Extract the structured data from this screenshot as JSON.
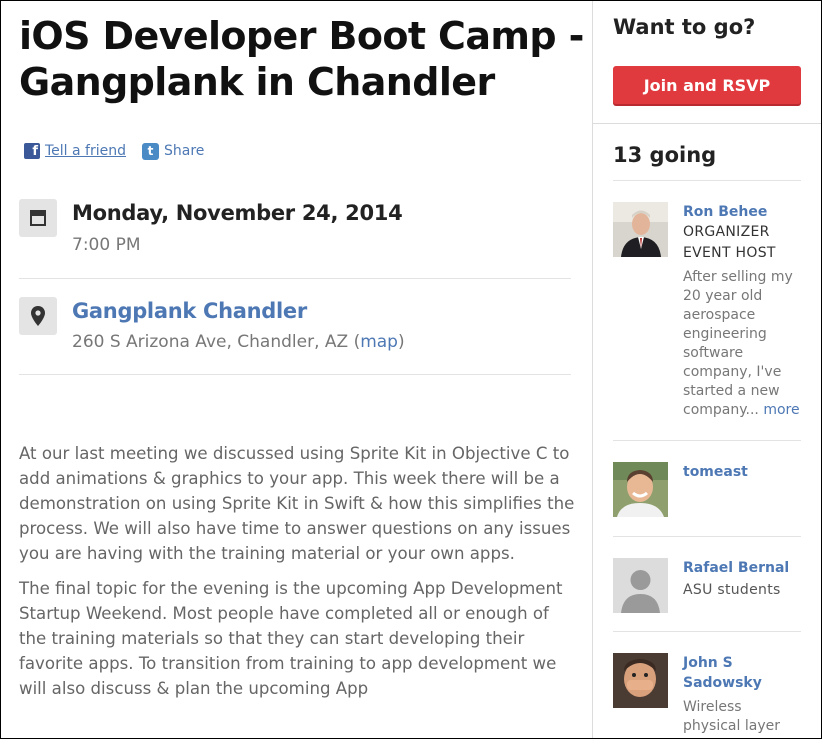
{
  "event": {
    "title": "iOS Developer Boot Camp - Gangplank in Chandler",
    "share": {
      "tell_friend": "Tell a friend",
      "share": "Share"
    },
    "date": "Monday, November 24, 2014",
    "time": "7:00 PM",
    "venue": {
      "name": "Gangplank Chandler",
      "address": "260 S Arizona Ave, Chandler, AZ",
      "map_open": "(",
      "map_label": "map",
      "map_close": ")"
    },
    "description": [
      "At our last meeting we discussed using Sprite Kit in Objective C to add animations & graphics to your app.  This week there will be a demonstration on using Sprite Kit in Swift & how this simplifies the process.  We will also have time to answer questions on any issues you are having with the training material or your own apps.",
      "The final topic for the evening is the upcoming App Development Startup Weekend.  Most people have completed all or enough of the training materials so that they can start developing their favorite apps.  To transition from training to app development we will also discuss & plan the upcoming App"
    ]
  },
  "sidebar": {
    "want_to_go": "Want to go?",
    "rsvp_label": "Join and RSVP",
    "going": "13 going",
    "members": [
      {
        "name": "Ron Behee",
        "role1": "ORGANIZER",
        "role2": "EVENT HOST",
        "bio": "After selling my 20 year old aerospace engineering software company, I've started a new company...",
        "more": "more",
        "avatar_icon": "photo-suit-avatar"
      },
      {
        "name": "tomeast",
        "avatar_icon": "photo-smiling-avatar"
      },
      {
        "name": "Rafael Bernal",
        "bio": "ASU students",
        "avatar_icon": "default-silhouette-avatar"
      },
      {
        "name": "John S Sadowsky",
        "bio": "Wireless physical layer",
        "avatar_icon": "photo-hands-avatar"
      }
    ]
  },
  "colors": {
    "link": "#4d78b4",
    "rsvp_button": "#e0393e",
    "facebook": "#3b5998",
    "twitter": "#4a8bc6"
  }
}
